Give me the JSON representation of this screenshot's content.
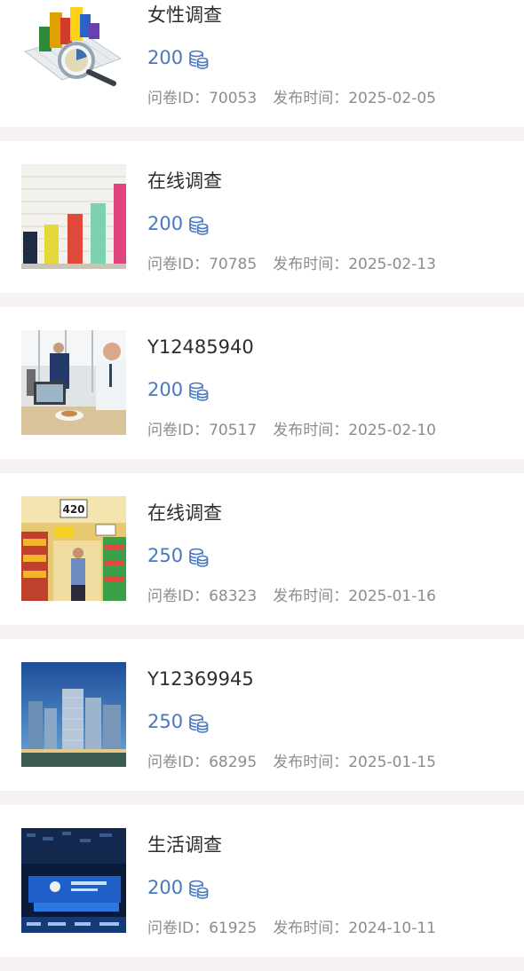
{
  "surveys": [
    {
      "title": "女性调查",
      "points": "200",
      "id_label": "问卷ID：",
      "id": "70053",
      "date_label": "发布时间：",
      "date": "2025-02-05",
      "thumb_icon": "analytics-chart-magnifier-image"
    },
    {
      "title": "在线调查",
      "points": "200",
      "id_label": "问卷ID：",
      "id": "70785",
      "date_label": "发布时间：",
      "date": "2025-02-13",
      "thumb_icon": "colorful-bar-chart-image"
    },
    {
      "title": "Y12485940",
      "points": "200",
      "id_label": "问卷ID：",
      "id": "70517",
      "date_label": "发布时间：",
      "date": "2025-02-10",
      "thumb_icon": "office-laptop-photo"
    },
    {
      "title": "在线调查",
      "points": "250",
      "id_label": "问卷ID：",
      "id": "68323",
      "date_label": "发布时间：",
      "date": "2025-01-16",
      "thumb_icon": "supermarket-aisle-photo"
    },
    {
      "title": "Y12369945",
      "points": "250",
      "id_label": "问卷ID：",
      "id": "68295",
      "date_label": "发布时间：",
      "date": "2025-01-15",
      "thumb_icon": "city-skyscrapers-photo"
    },
    {
      "title": "生活调查",
      "points": "200",
      "id_label": "问卷ID：",
      "id": "61925",
      "date_label": "发布时间：",
      "date": "2024-10-11",
      "thumb_icon": "finance-summit-stage-photo"
    }
  ],
  "colors": {
    "background": "#f6f2f4",
    "card": "#ffffff",
    "title": "#2d2d2d",
    "points": "#4a78bf",
    "meta": "#8c8c8c"
  }
}
